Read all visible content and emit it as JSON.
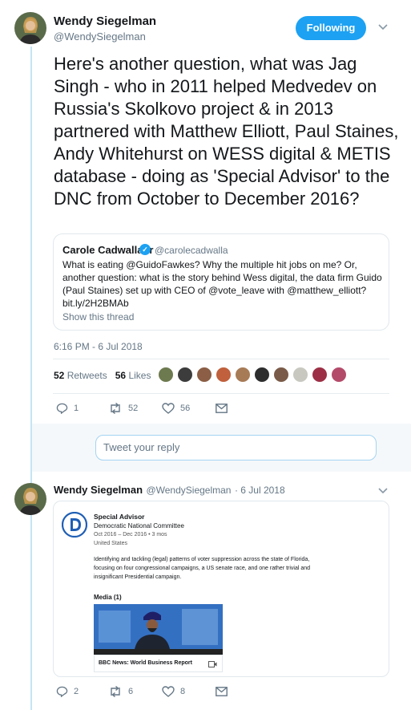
{
  "tweet": {
    "author_name": "Wendy Siegelman",
    "author_handle": "@WendySiegelman",
    "follow_label": "Following",
    "text": "Here's another question, what was Jag Singh - who in 2011 helped Medvedev on Russia's Skolkovo project & in 2013 partnered with Matthew Elliott, Paul Staines, Andy Whitehurst on WESS digital & METIS database - doing as 'Special Advisor' to the DNC from October to December 2016?",
    "timestamp": "6:16 PM - 6 Jul 2018",
    "retweets_count": "52",
    "retweets_label": "Retweets",
    "likes_count": "56",
    "likes_label": "Likes",
    "actions": {
      "replies": "1",
      "retweets": "52",
      "likes": "56"
    }
  },
  "quoted_tweet": {
    "author_name": "Carole Cadwalladr",
    "author_handle": "@carolecadwalla",
    "text": "What is eating @GuidoFawkes? Why the multiple hit jobs on me? Or, another question: what is the story behind Wess digital, the data firm Guido (Paul Staines) set up with CEO of @vote_leave with @matthew_elliott? bit.ly/2H2BMAb",
    "show_thread_label": "Show this thread"
  },
  "reply_box": {
    "placeholder": "Tweet your reply"
  },
  "reply_tweet": {
    "author_name": "Wendy Siegelman",
    "author_handle": "@WendySiegelman",
    "date": "· 6 Jul 2018",
    "card": {
      "title": "Special Advisor",
      "org": "Democratic National Committee",
      "dates": "Oct 2016 – Dec 2016  •  3 mos",
      "location": "United States",
      "desc_1": "Identifying and tackling (legal) patterns of voter suppression across the state of Florida,",
      "desc_2": "focusing on four congressional campaigns, a US senate race, and one rather trivial and",
      "desc_3": "insignificant Presidential campaign.",
      "media_label": "Media (1)",
      "media_caption": "BBC News: World Business Report"
    },
    "actions": {
      "replies": "2",
      "retweets": "6",
      "likes": "8"
    }
  },
  "colors": {
    "accent": "#1da1f2",
    "thread_line": "#c4e4f4",
    "muted": "#657786"
  }
}
